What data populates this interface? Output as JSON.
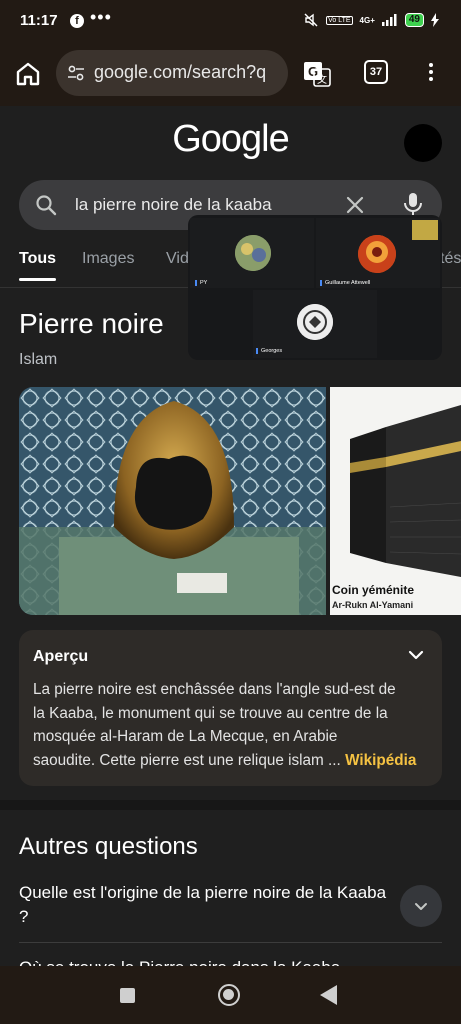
{
  "status_bar": {
    "time": "11:17",
    "notification_icon": "facebook-icon",
    "more": "•••",
    "network": "4G+",
    "battery": "49"
  },
  "toolbar": {
    "url": "google.com/search?q",
    "tab_count": "37"
  },
  "google": {
    "logo": "Google"
  },
  "search": {
    "query": "la pierre noire de la kaaba"
  },
  "filters": [
    {
      "label": "Tous",
      "active": true
    },
    {
      "label": "Images"
    },
    {
      "label": "Vid"
    },
    {
      "label": "tés"
    }
  ],
  "knowledge_panel": {
    "title": "Pierre noire",
    "subtitle": "Islam",
    "side_image_caption": "Coin yéménite",
    "side_image_subcaption": "Ar-Rukn Al-Yamani"
  },
  "apercu": {
    "heading": "Aperçu",
    "lines": [
      "La pierre noire est enchâssée dans l'angle sud-est de",
      "la Kaaba, le monument qui se trouve au centre de la",
      "mosquée al-Haram de La Mecque, en Arabie",
      "saoudite. Cette pierre est une relique islam"
    ],
    "ellipsis": " ... ",
    "source": "Wikipédia"
  },
  "autres_questions": {
    "title": "Autres questions",
    "items": [
      "Quelle est l'origine de la pierre noire de la Kaaba ?",
      "Où se trouve la Pierre noire dans la Kaaba"
    ]
  },
  "video_overlay": {
    "participants": [
      "PY",
      "Guillaume Attewell",
      "Georges"
    ]
  },
  "colors": {
    "browser_chrome": "#221a14",
    "page_background": "#1f1f1f",
    "source_link": "#f5c242"
  }
}
